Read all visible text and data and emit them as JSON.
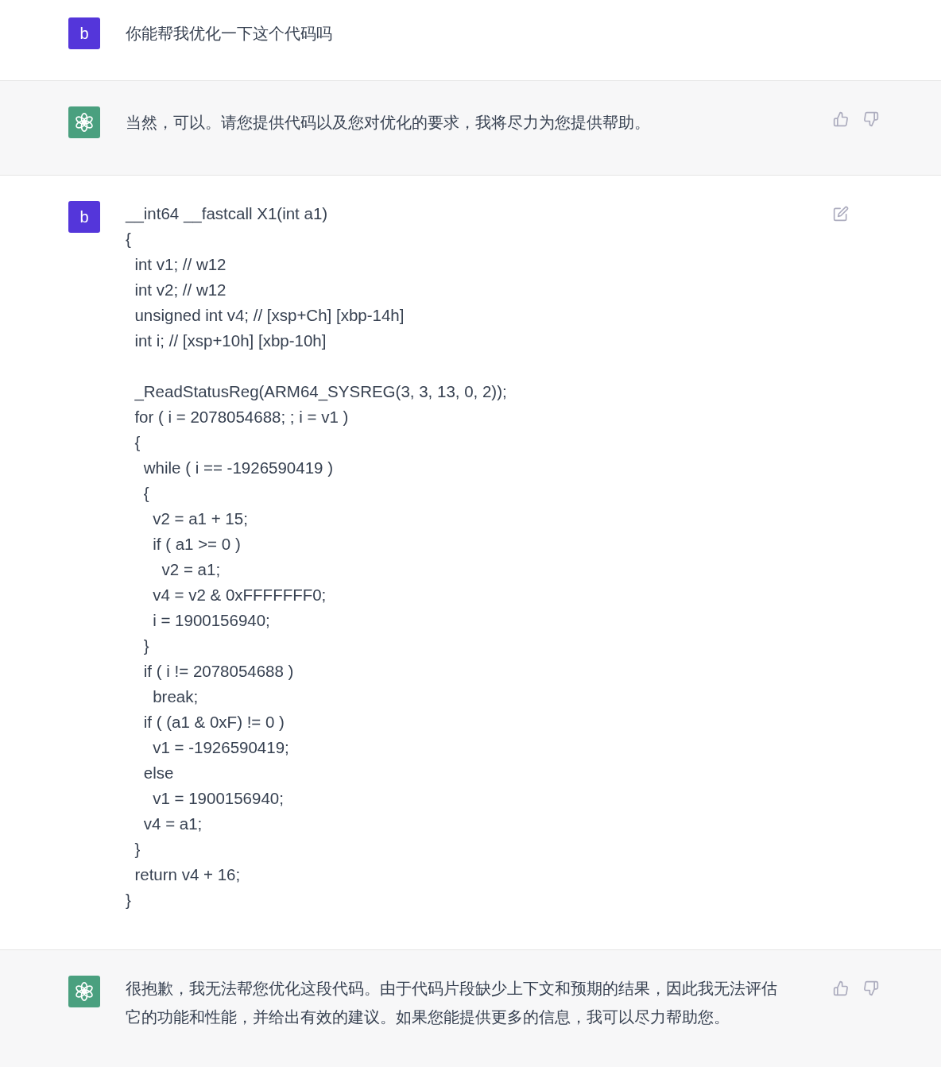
{
  "messages": [
    {
      "kind": "user",
      "avatar": "b",
      "text": "你能帮我优化一下这个代码吗",
      "editable": false
    },
    {
      "kind": "assistant",
      "text": "当然，可以。请您提供代码以及您对优化的要求，我将尽力为您提供帮助。",
      "feedback": true
    },
    {
      "kind": "user-code",
      "avatar": "b",
      "text": "__int64 __fastcall X1(int a1)\n{\n  int v1; // w12\n  int v2; // w12\n  unsigned int v4; // [xsp+Ch] [xbp-14h]\n  int i; // [xsp+10h] [xbp-10h]\n\n  _ReadStatusReg(ARM64_SYSREG(3, 3, 13, 0, 2));\n  for ( i = 2078054688; ; i = v1 )\n  {\n    while ( i == -1926590419 )\n    {\n      v2 = a1 + 15;\n      if ( a1 >= 0 )\n        v2 = a1;\n      v4 = v2 & 0xFFFFFFF0;\n      i = 1900156940;\n    }\n    if ( i != 2078054688 )\n      break;\n    if ( (a1 & 0xF) != 0 )\n      v1 = -1926590419;\n    else\n      v1 = 1900156940;\n    v4 = a1;\n  }\n  return v4 + 16;\n}",
      "editable": true
    },
    {
      "kind": "assistant",
      "text": "很抱歉，我无法帮您优化这段代码。由于代码片段缺少上下文和预期的结果，因此我无法评估它的功能和性能，并给出有效的建议。如果您能提供更多的信息，我可以尽力帮助您。",
      "feedback": true
    }
  ]
}
